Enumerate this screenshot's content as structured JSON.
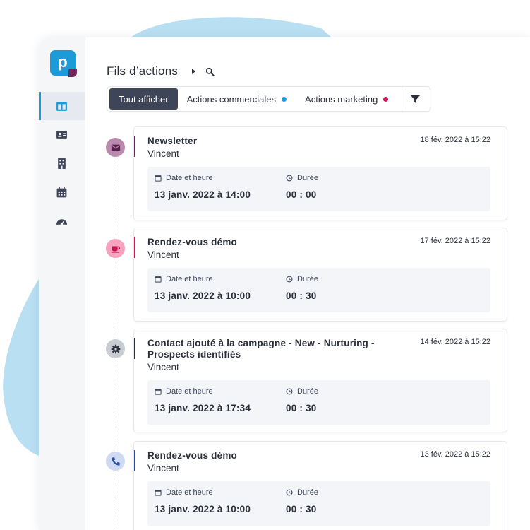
{
  "app": {
    "logo_letter": "p"
  },
  "sidebar": {
    "items": [
      {
        "name": "dashboard",
        "icon": "layout-icon",
        "active": true
      },
      {
        "name": "contacts",
        "icon": "contact-card-icon",
        "active": false
      },
      {
        "name": "companies",
        "icon": "building-icon",
        "active": false
      },
      {
        "name": "calendar",
        "icon": "calendar-icon",
        "active": false
      },
      {
        "name": "reports",
        "icon": "gauge-icon",
        "active": false
      }
    ]
  },
  "header": {
    "title": "Fils d’actions"
  },
  "filters": {
    "all": "Tout afficher",
    "commercial": "Actions commerciales",
    "marketing": "Actions marketing",
    "colors": {
      "commercial": "#1b9bd7",
      "marketing": "#d4145a"
    }
  },
  "labels": {
    "datetime": "Date et heure",
    "duration": "Durée"
  },
  "timeline": [
    {
      "title": "Newsletter",
      "user": "Vincent",
      "created": "18 fév. 2022 à 15:22",
      "datetime": "13 janv. 2022 à 14:00",
      "duration": "00 : 00",
      "icon": "envelope-icon",
      "accent": "#6a2b5a",
      "icon_bg": "#b98aae",
      "icon_fg": "#5a1f4d"
    },
    {
      "title": "Rendez-vous démo",
      "user": "Vincent",
      "created": "17 fév. 2022 à 15:22",
      "datetime": "13 janv. 2022 à 10:00",
      "duration": "00 : 30",
      "icon": "coffee-cup-icon",
      "accent": "#d4145a",
      "icon_bg": "#f7a3bf",
      "icon_fg": "#c2124f"
    },
    {
      "title": "Contact ajouté à la campagne - New - Nurturing - Prospects identifiés",
      "user": "Vincent",
      "created": "14 fév. 2022 à 15:22",
      "datetime": "13 janv. 2022 à 17:34",
      "duration": "00 : 30",
      "icon": "gear-icon",
      "accent": "#2b2f3a",
      "icon_bg": "#c9ccd2",
      "icon_fg": "#2b2f3a"
    },
    {
      "title": "Rendez-vous démo",
      "user": "Vincent",
      "created": "13 fév. 2022 à 15:22",
      "datetime": "13 janv. 2022 à 10:00",
      "duration": "00 : 30",
      "icon": "phone-icon",
      "accent": "#2b4fa3",
      "icon_bg": "#cfd9f2",
      "icon_fg": "#2b4fa3"
    }
  ]
}
